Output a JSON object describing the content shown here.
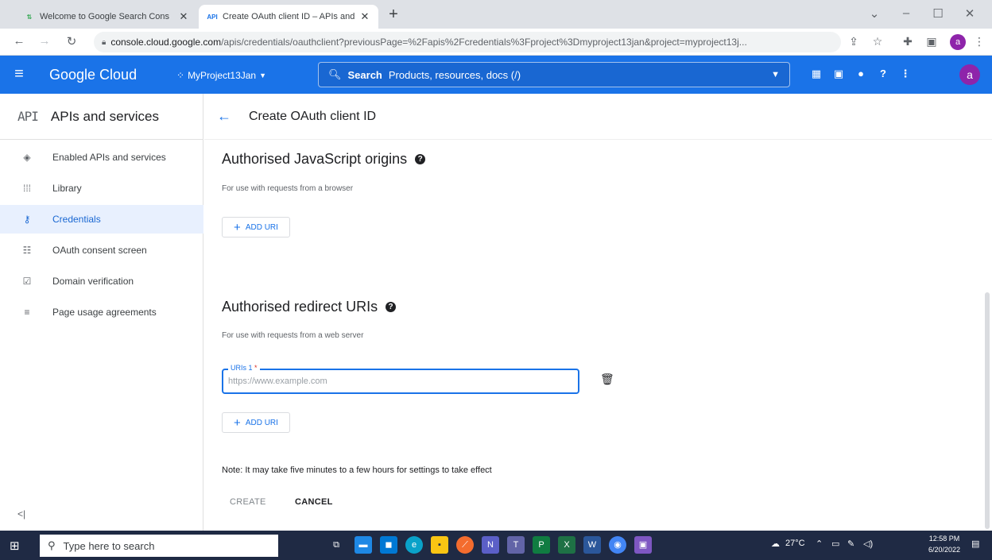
{
  "browser": {
    "tabs": [
      {
        "title": "Welcome to Google Search Cons",
        "active": false
      },
      {
        "title": "Create OAuth client ID – APIs and",
        "active": true
      }
    ],
    "new_tab": "+",
    "window_controls": [
      "⌄",
      "–",
      "☐",
      "✕"
    ],
    "url_host": "console.cloud.google.com",
    "url_path": "/apis/credentials/oauthclient?previousPage=%2Fapis%2Fcredentials%3Fproject%3Dmyproject13jan&project=myproject13j...",
    "profile_initial": "a"
  },
  "gcp": {
    "brand": "Google Cloud",
    "project": "MyProject13Jan",
    "search_bold": "Search",
    "search_placeholder": "Products, resources, docs (/)",
    "avatar_initial": "a"
  },
  "sidebar": {
    "api_badge": "API",
    "title": "APIs and services",
    "items": [
      {
        "label": "Enabled APIs and services",
        "icon": "apis-icon"
      },
      {
        "label": "Library",
        "icon": "library-icon"
      },
      {
        "label": "Credentials",
        "icon": "key-icon",
        "active": true
      },
      {
        "label": "OAuth consent screen",
        "icon": "consent-icon"
      },
      {
        "label": "Domain verification",
        "icon": "domain-icon"
      },
      {
        "label": "Page usage agreements",
        "icon": "agreements-icon"
      }
    ],
    "collapse": "<|"
  },
  "main": {
    "page_title": "Create OAuth client ID",
    "js_origins": {
      "title": "Authorised JavaScript origins",
      "subtitle": "For use with requests from a browser",
      "add_label": "ADD URI"
    },
    "redirect": {
      "title": "Authorised redirect URIs",
      "subtitle": "For use with requests from a web server",
      "field_label": "URIs 1",
      "field_required": "*",
      "field_placeholder": "https://www.example.com",
      "field_value": "",
      "add_label": "ADD URI"
    },
    "note": "Note: It may take five minutes to a few hours for settings to take effect",
    "create_label": "CREATE",
    "cancel_label": "CANCEL"
  },
  "taskbar": {
    "search_placeholder": "Type here to search",
    "weather": "27°C",
    "time": "12:58 PM",
    "date": "6/20/2022"
  },
  "colors": {
    "accent": "#1a73e8",
    "active_nav_bg": "#e8f0fe",
    "avatar": "#8e24aa",
    "taskbar": "#1f2a44"
  }
}
